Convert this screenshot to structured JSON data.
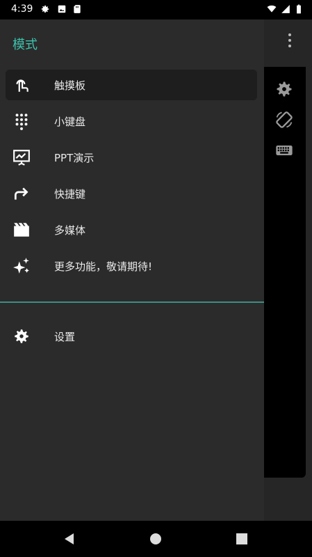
{
  "status_bar": {
    "time": "4:39",
    "left_icons": [
      "settings-icon",
      "image-icon",
      "sd-card-icon"
    ],
    "right_icons": [
      "wifi-icon",
      "signal-icon",
      "battery-icon"
    ]
  },
  "drawer": {
    "title": "模式",
    "accent_color": "#3ec3ad",
    "items": [
      {
        "label": "触摸板",
        "icon": "touch-icon",
        "selected": true
      },
      {
        "label": "小键盘",
        "icon": "dialpad-icon",
        "selected": false
      },
      {
        "label": "PPT演示",
        "icon": "presentation-icon",
        "selected": false
      },
      {
        "label": "快捷键",
        "icon": "shortcut-arrow-icon",
        "selected": false
      },
      {
        "label": "多媒体",
        "icon": "movie-icon",
        "selected": false
      },
      {
        "label": "更多功能，敬请期待!",
        "icon": "sparkle-icon",
        "selected": false
      }
    ],
    "settings": {
      "label": "设置",
      "icon": "gear-icon"
    }
  },
  "side_toolbar": {
    "icons": [
      "settings-icon",
      "rotate-icon",
      "keyboard-icon",
      "more-vert-icon"
    ]
  },
  "nav_bar": {
    "icons": [
      "back-icon",
      "home-icon",
      "recents-icon"
    ]
  }
}
